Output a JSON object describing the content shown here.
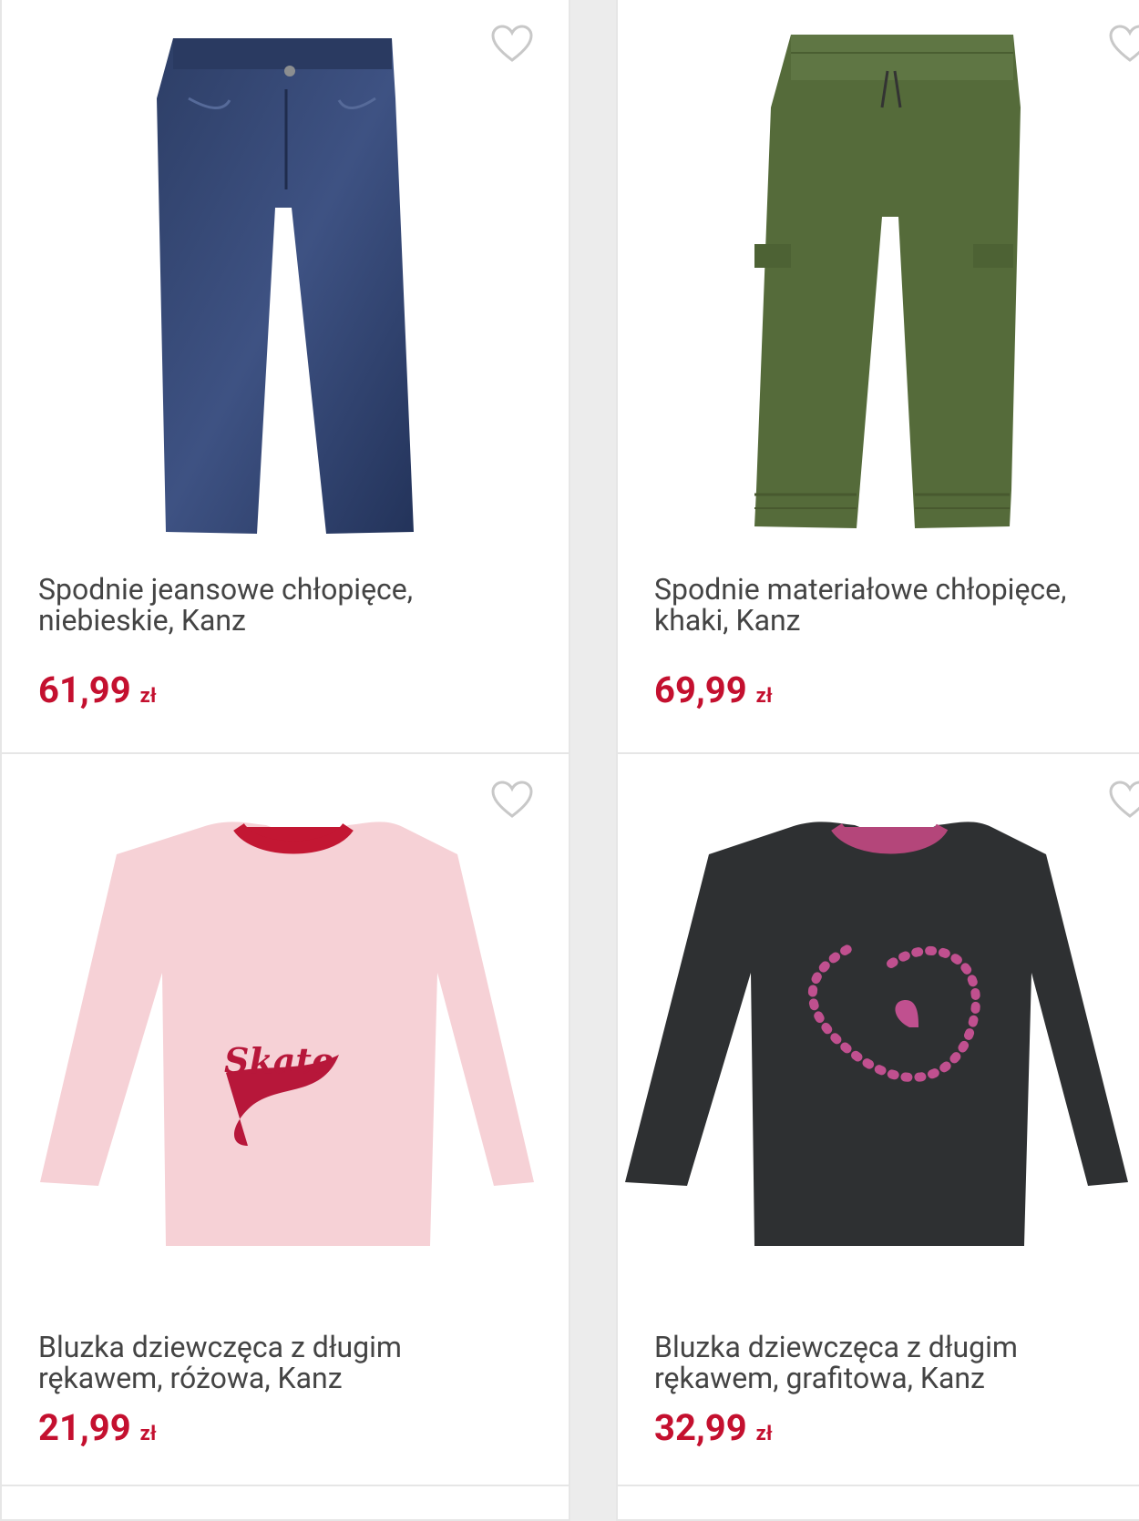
{
  "colors": {
    "price": "#c4102f",
    "text": "#444444",
    "border": "#e6e6e6",
    "heart": "#c8c8c8"
  },
  "products": [
    {
      "name": "Spodnie jeansowe chłopięce, niebieskie, Kanz",
      "price": "61,99",
      "currency": "zł",
      "image": "blue-jeans",
      "favorite_icon": "heart-outline-icon"
    },
    {
      "name": "Spodnie materiałowe chłopięce, khaki, Kanz",
      "price": "69,99",
      "currency": "zł",
      "image": "khaki-cargo-pants",
      "favorite_icon": "heart-outline-icon"
    },
    {
      "name": "Bluzka dziewczęca z długim rękawem, różowa, Kanz",
      "price": "21,99",
      "currency": "zł",
      "image": "pink-skate-shirt",
      "image_text": "Skate",
      "favorite_icon": "heart-outline-icon"
    },
    {
      "name": "Bluzka dziewczęca z długim rękawem, grafitowa, Kanz",
      "price": "32,99",
      "currency": "zł",
      "image": "graphite-heart-shirt",
      "favorite_icon": "heart-outline-icon"
    }
  ]
}
